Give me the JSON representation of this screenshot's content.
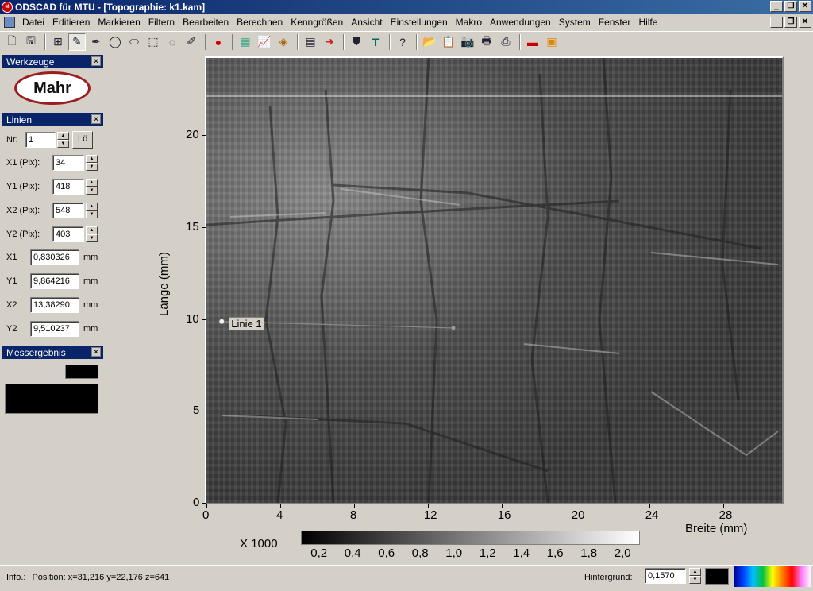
{
  "window": {
    "title": "ODSCAD für MTU - [Topographie:  k1.kam]",
    "controls": [
      "_",
      "❐",
      "✕"
    ]
  },
  "menu": [
    "Datei",
    "Editieren",
    "Markieren",
    "Filtern",
    "Bearbeiten",
    "Berechnen",
    "Kenngrößen",
    "Ansicht",
    "Einstellungen",
    "Makro",
    "Anwendungen",
    "System",
    "Fenster",
    "Hilfe"
  ],
  "panels": {
    "werkzeuge": {
      "title": "Werkzeuge",
      "logo_text": "Mahr"
    },
    "linien": {
      "title": "Linien",
      "nr_label": "Nr:",
      "nr_value": "1",
      "delete_button": "Lö",
      "pix_fields": [
        {
          "label": "X1 (Pix):",
          "value": "34"
        },
        {
          "label": "Y1 (Pix):",
          "value": "418"
        },
        {
          "label": "X2 (Pix):",
          "value": "548"
        },
        {
          "label": "Y2 (Pix):",
          "value": "403"
        }
      ],
      "mm_fields": [
        {
          "label": "X1",
          "value": "0,830326",
          "unit": "mm"
        },
        {
          "label": "Y1",
          "value": "9,864216",
          "unit": "mm"
        },
        {
          "label": "X2",
          "value": "13,38290",
          "unit": "mm"
        },
        {
          "label": "Y2",
          "value": "9,510237",
          "unit": "mm"
        }
      ]
    },
    "messergebnis": {
      "title": "Messergebnis"
    }
  },
  "plot": {
    "xlabel": "Breite  (mm)",
    "ylabel": "Länge  (mm)",
    "x_ticks": [
      "0",
      "4",
      "8",
      "12",
      "16",
      "20",
      "24",
      "28"
    ],
    "y_ticks": [
      "0",
      "5",
      "10",
      "15",
      "20"
    ],
    "line_label": "Linie 1",
    "line": {
      "x1_mm": 0.830326,
      "y1_mm": 9.864216,
      "x2_mm": 13.3829,
      "y2_mm": 9.510237
    },
    "x_range": [
      0,
      31.2
    ],
    "y_range": [
      0,
      24.2
    ]
  },
  "colorbar": {
    "multiplier": "X 1000",
    "ticks": [
      "0,2",
      "0,4",
      "0,6",
      "0,8",
      "1,0",
      "1,2",
      "1,4",
      "1,6",
      "1,8",
      "2,0"
    ]
  },
  "status": {
    "info_label": "Info.:",
    "position_text": "Position:  x=31,216   y=22,176   z=641",
    "hintergrund_label": "Hintergrund:",
    "hintergrund_value": "0,1570"
  }
}
